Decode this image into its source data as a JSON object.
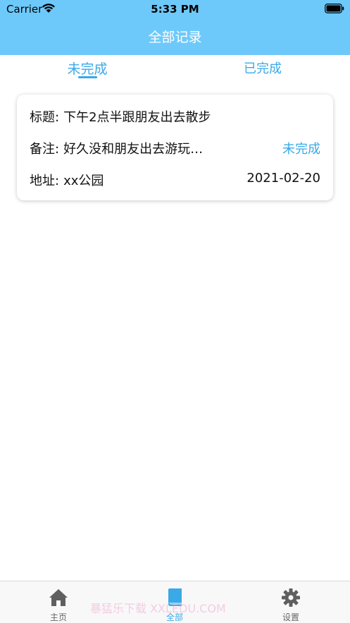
{
  "status_bar": {
    "carrier": "Carrier",
    "time": "5:33 PM",
    "wifi_icon": "wifi-icon",
    "battery_icon": "battery-icon"
  },
  "header": {
    "title": "全部记录",
    "background_color": "#6ec9fb"
  },
  "tabs": [
    {
      "label": "未完成",
      "selected": true
    },
    {
      "label": "已完成",
      "selected": false
    }
  ],
  "records": [
    {
      "title_label": "标题:",
      "title_value": "下午2点半跟朋友出去散步",
      "note_label": "备注:",
      "note_value": "好久没和朋友出去游玩…",
      "status": "未完成",
      "address_label": "地址:",
      "address_value": "xx公园",
      "date": "2021-02-20"
    }
  ],
  "tabbar": [
    {
      "label": "主页",
      "icon": "home-icon",
      "selected": false
    },
    {
      "label": "全部",
      "icon": "book-icon",
      "selected": true
    },
    {
      "label": "设置",
      "icon": "gear-icon",
      "selected": false
    }
  ],
  "watermark": "暴猛乐下载 XXLEDU.COM",
  "colors": {
    "accent": "#3aa9e8",
    "header": "#6ec9fb"
  }
}
